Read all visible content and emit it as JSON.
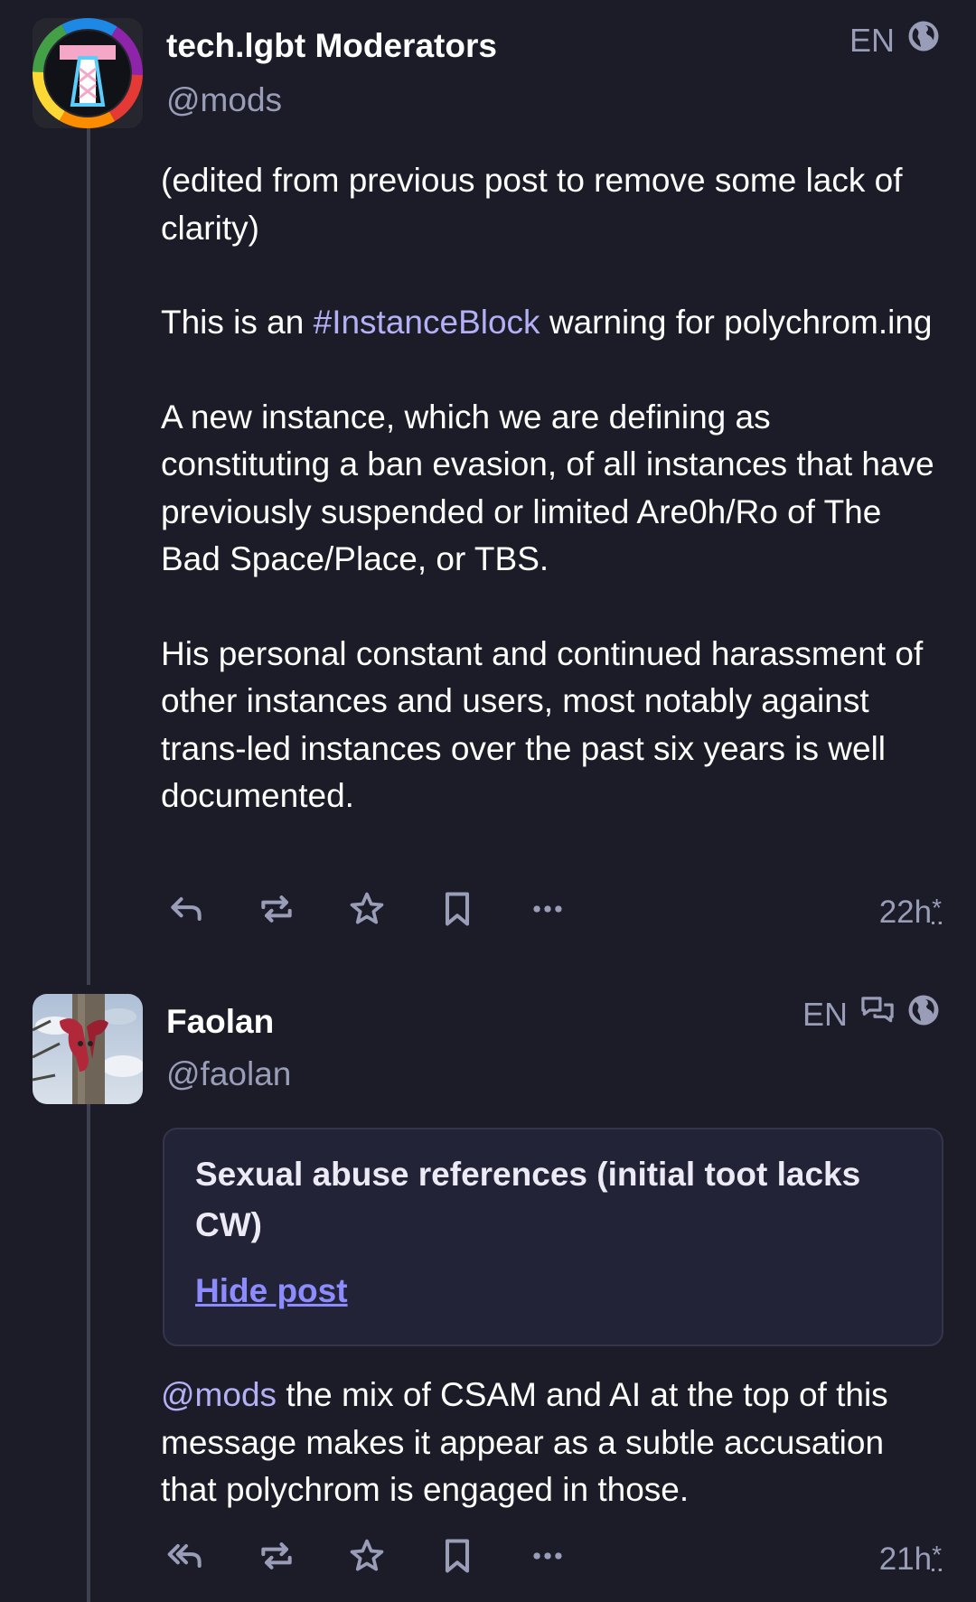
{
  "posts": [
    {
      "display_name": "tech.lgbt Moderators",
      "handle": "@mods",
      "language": "EN",
      "paragraphs": {
        "p1": "(edited from previous post to remove some lack of clarity)",
        "p2_pre": "This is an ",
        "p2_tag": "#InstanceBlock",
        "p2_post": " warning for polychrom.ing",
        "p3": "A new instance, which we are defining as constituting a ban evasion, of all instances that have previously suspended or limited Are0h/Ro of The Bad Space/Place, or TBS.",
        "p4": "His personal constant and continued harassment of other instances and users, most notably against trans-led instances over the past six years is well documented."
      },
      "timestamp": "22h",
      "timestamp_mark": "*",
      "icons": [
        "globe-icon"
      ]
    },
    {
      "display_name": "Faolan",
      "handle": "@faolan",
      "language": "EN",
      "content_warning": "Sexual abuse references (initial toot lacks CW)",
      "cw_toggle": "Hide post",
      "mention": "@mods",
      "body": " the mix of CSAM and AI at the top of this message makes it appear as a subtle accusation that polychrom is engaged in those.",
      "timestamp": "21h",
      "timestamp_mark": "*",
      "icons": [
        "conversation-icon",
        "globe-icon"
      ]
    }
  ],
  "colors": {
    "background": "#1c1c28",
    "link": "#b3b0f5",
    "muted": "#9a9db8",
    "cw_toggle": "#8c8cff"
  }
}
